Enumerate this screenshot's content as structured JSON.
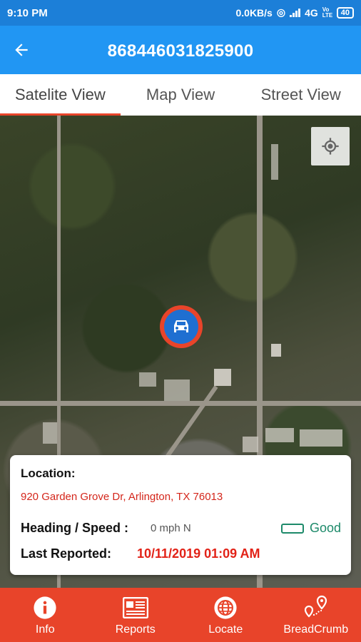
{
  "status_bar": {
    "time": "9:10 PM",
    "speed": "0.0KB/s",
    "network": "4G",
    "volte": "Vo LTE",
    "battery": "40"
  },
  "app_bar": {
    "title": "868446031825900",
    "back_icon": "arrow-left-icon"
  },
  "tabs": [
    {
      "label": "Satelite View",
      "active": true
    },
    {
      "label": "Map View",
      "active": false
    },
    {
      "label": "Street View",
      "active": false
    }
  ],
  "map": {
    "locate_icon": "crosshair-icon",
    "marker_icon": "car-icon"
  },
  "info_card": {
    "location_label": "Location:",
    "address": "920 Garden Grove Dr, Arlington, TX 76013",
    "heading_label": "Heading / Speed :",
    "heading_value": "0 mph N",
    "status": "Good",
    "reported_label": "Last Reported:",
    "reported_value": "10/11/2019 01:09 AM"
  },
  "bottom_nav": [
    {
      "label": "Info",
      "icon": "info-icon"
    },
    {
      "label": "Reports",
      "icon": "report-icon"
    },
    {
      "label": "Locate",
      "icon": "globe-icon"
    },
    {
      "label": "BreadCrumb",
      "icon": "breadcrumb-icon"
    }
  ],
  "colors": {
    "primary": "#2196f3",
    "accent": "#e8442a",
    "address": "#d4261b",
    "good": "#1d8a6a"
  }
}
